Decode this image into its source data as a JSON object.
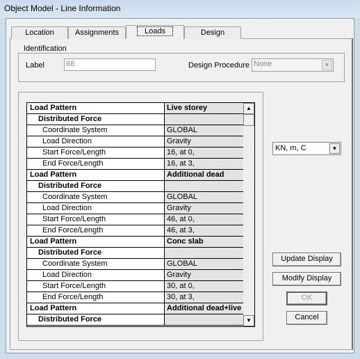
{
  "window": {
    "title": "Object Model - Line Information"
  },
  "tabs": [
    {
      "label": "Location"
    },
    {
      "label": "Assignments"
    },
    {
      "label": "Loads",
      "active": true
    },
    {
      "label": "Design"
    }
  ],
  "identification": {
    "title": "Identification",
    "label_caption": "Label",
    "label_value": "68",
    "design_procedure_caption": "Design Procedure",
    "design_procedure_value": "None"
  },
  "table": {
    "rows": [
      {
        "name": "Load Pattern",
        "value": "Live storey",
        "level": 0
      },
      {
        "name": "Distributed Force",
        "value": "",
        "level": 1
      },
      {
        "name": "Coordinate System",
        "value": "GLOBAL",
        "level": 2
      },
      {
        "name": "Load Direction",
        "value": "Gravity",
        "level": 2
      },
      {
        "name": "Start Force/Length",
        "value": "16, at 0,",
        "level": 2
      },
      {
        "name": "End Force/Length",
        "value": "16, at 3,",
        "level": 2
      },
      {
        "name": "Load Pattern",
        "value": "Additional dead",
        "level": 0
      },
      {
        "name": "Distributed Force",
        "value": "",
        "level": 1
      },
      {
        "name": "Coordinate System",
        "value": "GLOBAL",
        "level": 2
      },
      {
        "name": "Load Direction",
        "value": "Gravity",
        "level": 2
      },
      {
        "name": "Start Force/Length",
        "value": "46, at 0,",
        "level": 2
      },
      {
        "name": "End Force/Length",
        "value": "46, at 3,",
        "level": 2
      },
      {
        "name": "Load Pattern",
        "value": "Conc slab",
        "level": 0
      },
      {
        "name": "Distributed Force",
        "value": "",
        "level": 1
      },
      {
        "name": "Coordinate System",
        "value": "GLOBAL",
        "level": 2
      },
      {
        "name": "Load Direction",
        "value": "Gravity",
        "level": 2
      },
      {
        "name": "Start Force/Length",
        "value": "30, at 0,",
        "level": 2
      },
      {
        "name": "End Force/Length",
        "value": "30, at 3,",
        "level": 2
      },
      {
        "name": "Load Pattern",
        "value": "Additional dead+live",
        "level": 0
      },
      {
        "name": "Distributed Force",
        "value": "",
        "level": 1
      }
    ]
  },
  "units": {
    "value": "KN, m, C"
  },
  "buttons": {
    "update": "Update Display",
    "modify": "Modify Display",
    "ok": "OK",
    "cancel": "Cancel"
  },
  "icons": {
    "scroll_up": "▲",
    "scroll_down": "▼",
    "dropdown": "▼"
  }
}
